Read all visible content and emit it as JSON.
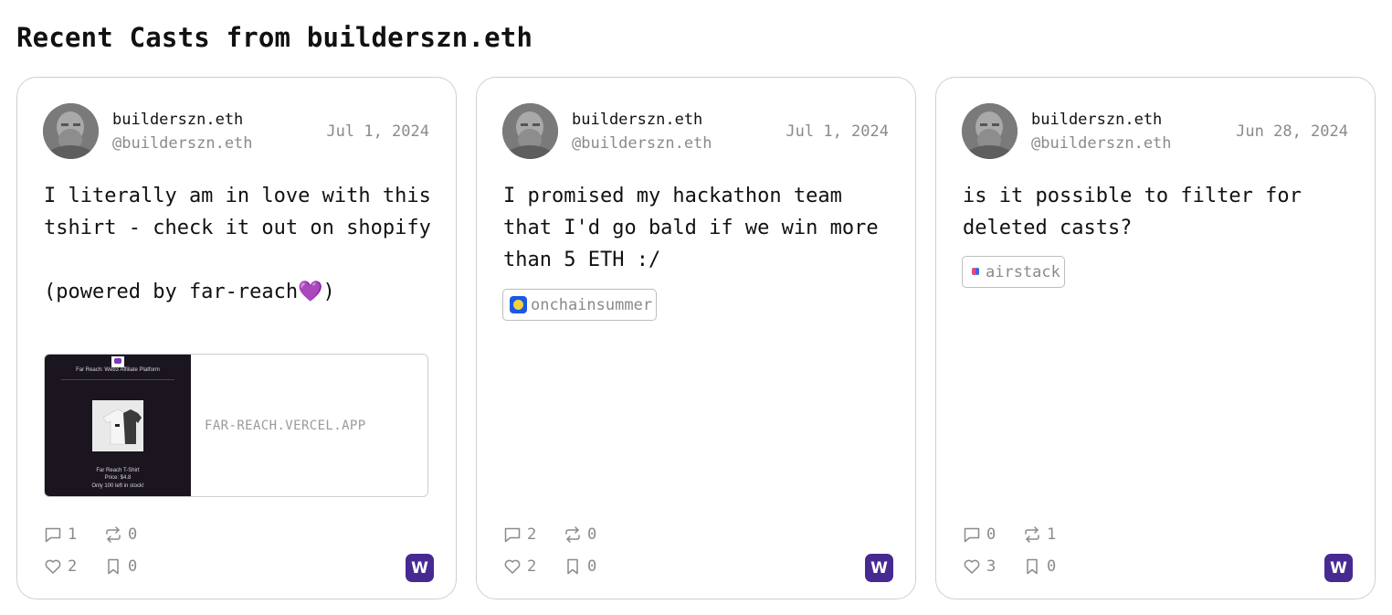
{
  "page": {
    "title": "Recent Casts from builderszn.eth"
  },
  "colors": {
    "brand_badge": "#472a91",
    "muted": "#8a8a8a",
    "border": "#cfcfcf"
  },
  "icons": {
    "reply": "comment-icon",
    "recast": "recast-icon",
    "like": "heart-icon",
    "bookmark": "bookmark-icon",
    "client": "warpcast-logo-icon"
  },
  "casts": [
    {
      "author": {
        "display_name": "builderszn.eth",
        "username": "@builderszn.eth"
      },
      "date": "Jul 1, 2024",
      "text": "I literally am in love with this tshirt - check it out on shopify\n\n(powered by far-reach💜)",
      "embed": {
        "url": "FAR-REACH.VERCEL.APP",
        "image_title": "Far Reach: Web3 Affiliate Platform",
        "image_caption_1": "Far Reach T-Shirt",
        "image_caption_2": "Price: $4.8",
        "image_caption_3": "Only 100 left in stock!"
      },
      "stats": {
        "replies": "1",
        "recasts": "0",
        "likes": "2",
        "bookmarks": "0"
      },
      "client_badge": "W"
    },
    {
      "author": {
        "display_name": "builderszn.eth",
        "username": "@builderszn.eth"
      },
      "date": "Jul 1, 2024",
      "text": "I promised my hackathon team that I'd go bald if we win more than 5 ETH :/",
      "channel": "onchainsummer",
      "stats": {
        "replies": "2",
        "recasts": "0",
        "likes": "2",
        "bookmarks": "0"
      },
      "client_badge": "W"
    },
    {
      "author": {
        "display_name": "builderszn.eth",
        "username": "@builderszn.eth"
      },
      "date": "Jun 28, 2024",
      "text": "is it possible to filter for deleted casts?",
      "channel": "airstack",
      "stats": {
        "replies": "0",
        "recasts": "1",
        "likes": "3",
        "bookmarks": "0"
      },
      "client_badge": "W"
    }
  ]
}
